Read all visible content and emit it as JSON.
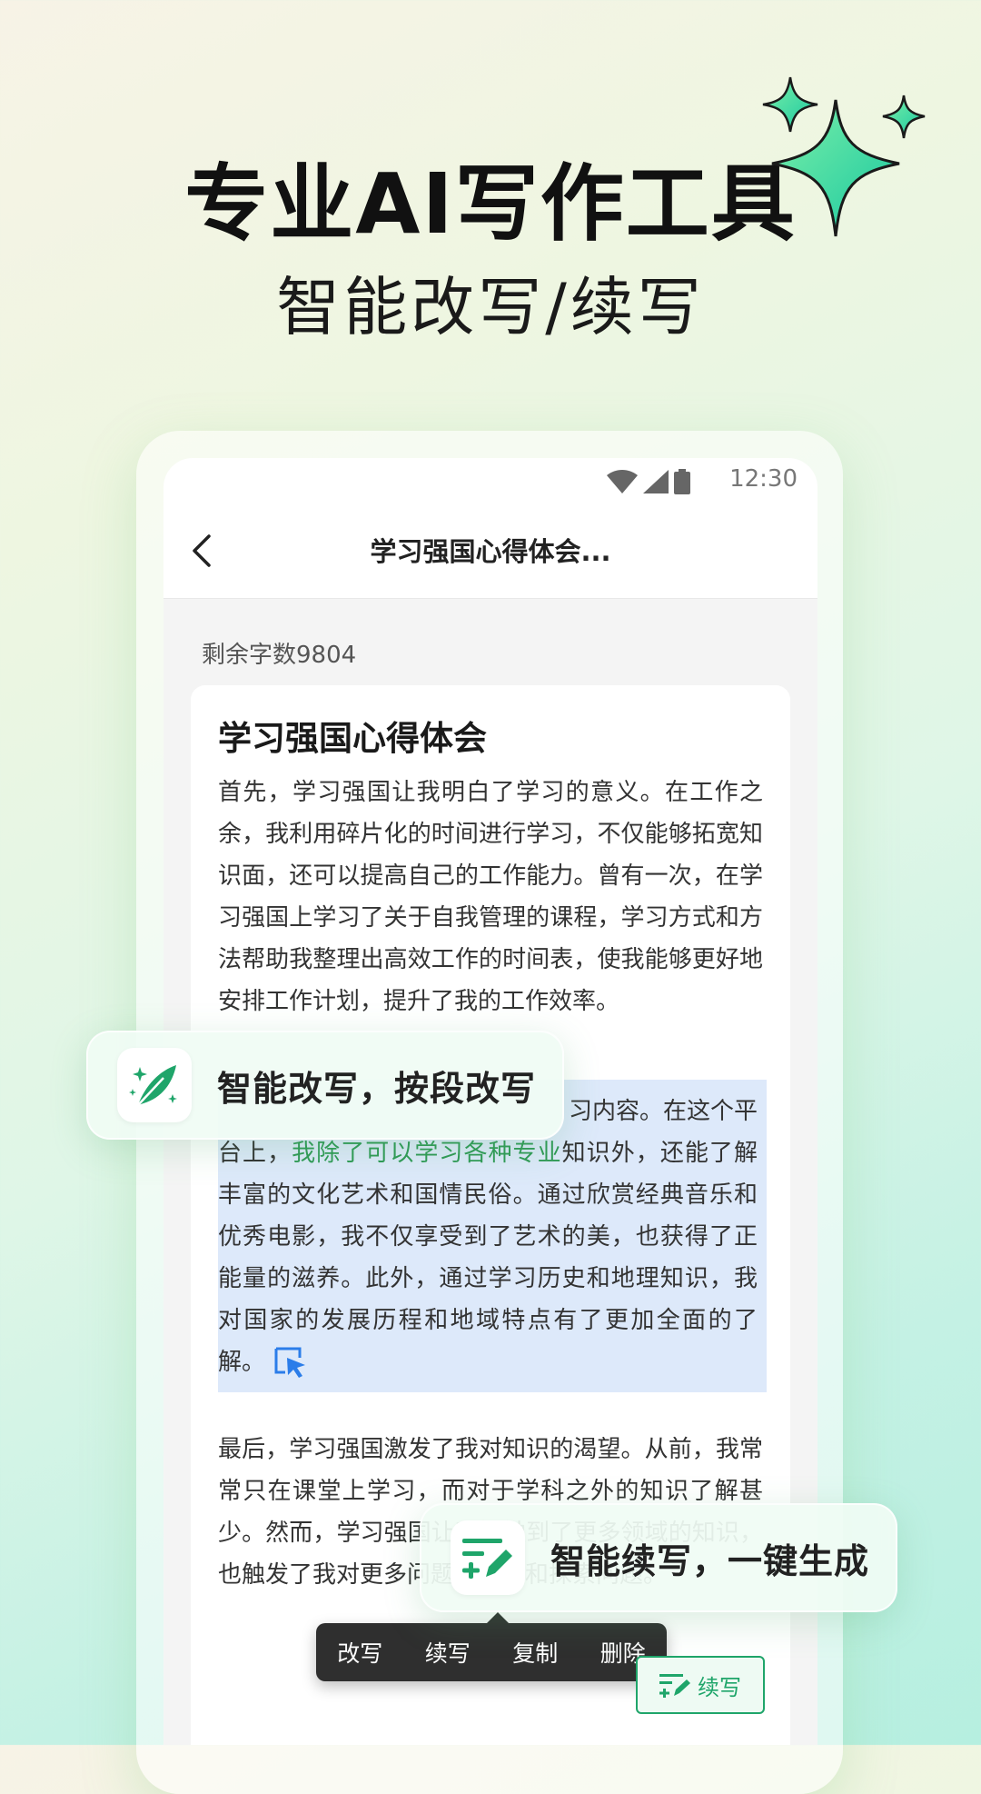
{
  "hero": {
    "title": "专业AI写作工具",
    "subtitle": "智能改写/续写"
  },
  "status_bar": {
    "time": "12:30",
    "icons": [
      "wifi-icon",
      "signal-icon",
      "battery-icon"
    ]
  },
  "header": {
    "back_icon": "chevron-left-icon",
    "title": "学习强国心得体会..."
  },
  "remaining_words": "剩余字数9804",
  "document": {
    "title": "学习强国心得体会",
    "paragraph1": "首先，学习强国让我明白了学习的意义。在工作之余，我利用碎片化的时间进行学习，不仅能够拓宽知识面，还可以提高自己的工作能力。曾有一次，在学习强国上学习了关于自我管理的课程，学习方式和方法帮助我整理出高效工作的时间表，使我能够更好地安排工作计划，提升了我的工作效率。",
    "paragraph2_visible_start": "习内容。在这个平",
    "paragraph2_line2_a": "台上，",
    "paragraph2_line2_highlight": "我除了可以学习各种专业",
    "paragraph2_line2_b": "知识外，还能了解",
    "paragraph2_rest": "丰富的文化艺术和国情民俗。通过欣赏经典音乐和优秀电影，我不仅享受到了艺术的美，也获得了正能量的滋养。此外，通过学习历史和地理知识，我对国家的发展历程和地域特点有了更加全面的了解。",
    "paragraph3": "最后，学习强国激发了我对知识的渴望。从前，我常常只在课堂上学习，而对于学科之外的知识了解甚少。然而，学习强国让我接触到了更多领域的知识，也触发了我对更多问题的思考和探索问题。"
  },
  "context_menu": {
    "items": [
      "改写",
      "续写",
      "复制",
      "删除"
    ]
  },
  "continue_button": {
    "label": "续写"
  },
  "callouts": {
    "rewrite": "智能改写，按段改写",
    "continue": "智能续写，一键生成"
  },
  "colors": {
    "accent_green": "#1fa56a",
    "highlight_blue": "#dde9fa",
    "highlight_text": "#2f9a55"
  }
}
